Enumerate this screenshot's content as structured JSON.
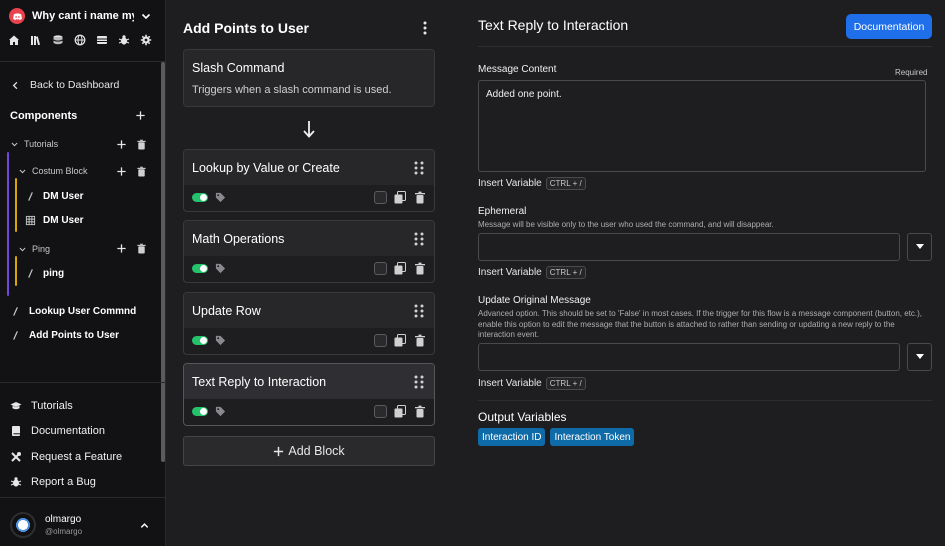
{
  "server": {
    "name": "Why cant i name my..."
  },
  "sidebar": {
    "back_label": "Back to Dashboard",
    "components_label": "Components",
    "tree": {
      "tutorials": "Tutorials",
      "costum_block": "Costum Block",
      "dm_user_1": "DM User",
      "dm_user_2": "DM User",
      "ping_group": "Ping",
      "ping": "ping",
      "lookup": "Lookup User Commnd",
      "add_points": "Add Points to User"
    },
    "footer": {
      "tutorials": "Tutorials",
      "documentation": "Documentation",
      "request": "Request a Feature",
      "report": "Report a Bug"
    },
    "user": {
      "name": "olmargo",
      "handle": "@olmargo"
    }
  },
  "flow": {
    "title": "Add Points to User",
    "trigger": {
      "title": "Slash Command",
      "desc": "Triggers when a slash command is used."
    },
    "blocks": [
      {
        "title": "Lookup by Value or Create"
      },
      {
        "title": "Math Operations"
      },
      {
        "title": "Update Row"
      },
      {
        "title": "Text Reply to Interaction"
      }
    ],
    "add_block_label": "Add Block"
  },
  "panel": {
    "title": "Text Reply to Interaction",
    "doc_button": "Documentation",
    "message": {
      "label": "Message Content",
      "required": "Required",
      "value": "Added one point."
    },
    "insert_variable": "Insert Variable",
    "shortcut": "CTRL + /",
    "ephemeral": {
      "label": "Ephemeral",
      "help": "Message will be visible only to the user who used the command, and will disappear."
    },
    "update_original": {
      "label": "Update Original Message",
      "help": "Advanced option. This should be set to 'False' in most cases. If the trigger for this flow is a message component (button, etc.), enable this option to edit the message that the button is attached to rather than sending or updating a new reply to the interaction event."
    },
    "output": {
      "label": "Output Variables",
      "chips": [
        "Interaction ID",
        "Interaction Token"
      ]
    }
  },
  "colors": {
    "accent": "#1f6feb",
    "toggle_on": "#23c26b",
    "chip": "#0e6ba8",
    "tree_purple": "#6b4bd8",
    "tree_yellow": "#d8a800"
  }
}
